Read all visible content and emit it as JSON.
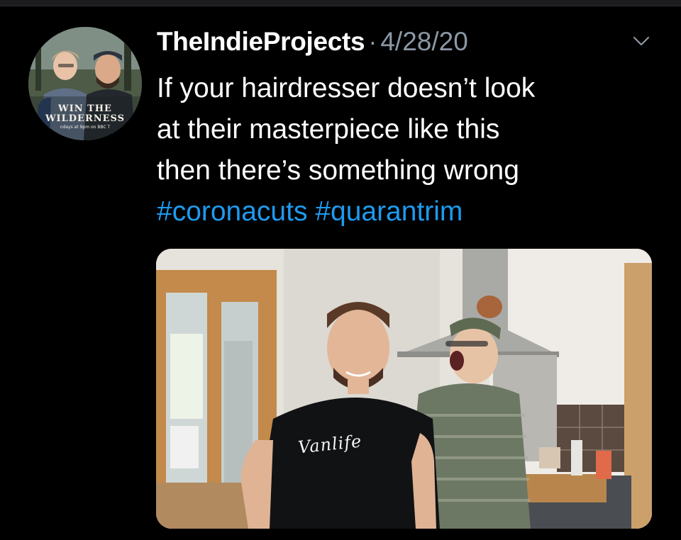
{
  "tweet": {
    "username": "TheIndieProjects",
    "separator": "·",
    "date": "4/28/20",
    "text_lines": [
      "If your hairdresser doesn’t look",
      "at their masterpiece like this",
      "then there’s something wrong"
    ],
    "hashtags": [
      "#coronacuts",
      "#quarantrim"
    ]
  },
  "avatar": {
    "icon": "profile-avatar",
    "line1": "WIN THE",
    "line2": "WILDERNESS",
    "line3": "ndays at 9pm on BBC T"
  },
  "media": {
    "shirt_text": "Vanlife"
  },
  "icons": {
    "menu": "chevron-down-icon"
  },
  "colors": {
    "background": "#000000",
    "text": "#ffffff",
    "muted": "#8b98a5",
    "hashtag": "#1d9bf0"
  }
}
